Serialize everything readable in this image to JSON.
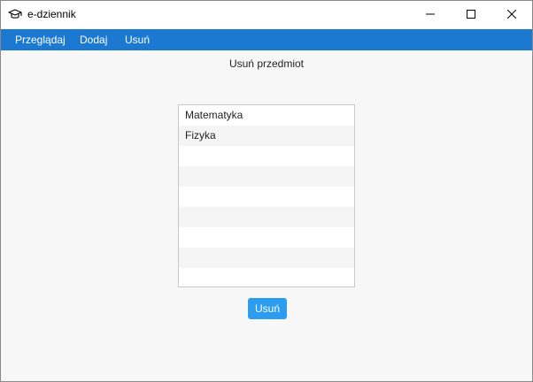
{
  "window": {
    "title": "e-dziennik",
    "app_icon": "graduation-cap-icon",
    "controls": [
      "minimize-icon",
      "maximize-icon",
      "close-icon"
    ]
  },
  "menu": {
    "items": [
      {
        "label": "Przeglądaj"
      },
      {
        "label": "Dodaj"
      },
      {
        "label": "Usuń"
      }
    ],
    "background_color": "#1c79d2"
  },
  "main": {
    "heading": "Usuń przedmiot",
    "list": {
      "items": [
        {
          "label": "Matematyka"
        },
        {
          "label": "Fizyka"
        },
        {
          "label": ""
        },
        {
          "label": ""
        },
        {
          "label": ""
        },
        {
          "label": ""
        },
        {
          "label": ""
        },
        {
          "label": ""
        },
        {
          "label": ""
        }
      ]
    },
    "delete_button": {
      "label": "Usuń",
      "color": "#2c9cf0"
    }
  }
}
